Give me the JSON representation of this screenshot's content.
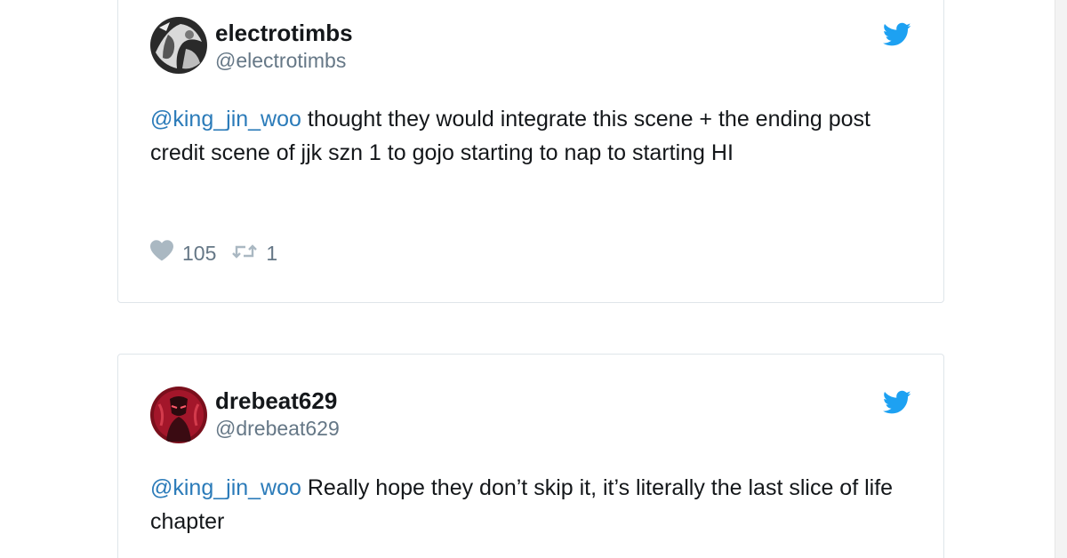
{
  "colors": {
    "twitter_blue": "#1da1f2",
    "mention_blue": "#2b7bb9",
    "text_dark": "#14171a",
    "text_gray": "#657786",
    "border": "#dfe5ea"
  },
  "tweets": [
    {
      "display_name": "electrotimbs",
      "handle": "@electrotimbs",
      "mention": "@king_jin_woo",
      "text": " thought they would integrate this scene + the ending post credit scene of jjk szn 1 to gojo starting to nap to starting HI",
      "like_count": "105",
      "retweet_count": "1",
      "icons": [
        "avatar-image",
        "twitter-bird-icon",
        "heart-icon",
        "retweet-icon"
      ]
    },
    {
      "display_name": "drebeat629",
      "handle": "@drebeat629",
      "mention": "@king_jin_woo",
      "text": " Really hope they don’t skip it, it’s literally the last slice of life chapter",
      "icons": [
        "avatar-image",
        "twitter-bird-icon"
      ]
    }
  ]
}
